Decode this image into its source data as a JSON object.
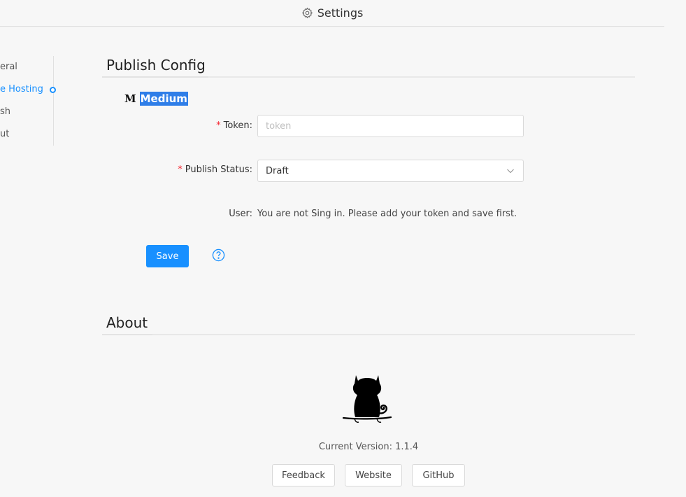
{
  "window": {
    "title": "Settings",
    "icon": "gear-icon"
  },
  "sidebar": {
    "items": [
      {
        "label": "eral"
      },
      {
        "label": "e Hosting",
        "active": true
      },
      {
        "label": "sh"
      },
      {
        "label": "ut"
      }
    ]
  },
  "publish_config": {
    "title": "Publish Config",
    "platform_logo": "M",
    "platform_name": "Medium",
    "token": {
      "label": "Token:",
      "placeholder": "token",
      "value": ""
    },
    "publish_status": {
      "label": "Publish Status:",
      "value": "Draft"
    },
    "user": {
      "label": "User:",
      "value": "You are not Sing in. Please add your token and save first."
    },
    "save_label": "Save",
    "help_icon": "question-circle-icon"
  },
  "about": {
    "title": "About",
    "logo_icon": "cat-logo-icon",
    "version_text": "Current Version: 1.1.4",
    "buttons": {
      "feedback": "Feedback",
      "website": "Website",
      "github": "GitHub"
    }
  },
  "colors": {
    "accent": "#1890ff",
    "required": "#f5222d",
    "highlight": "#2f7ee8"
  }
}
